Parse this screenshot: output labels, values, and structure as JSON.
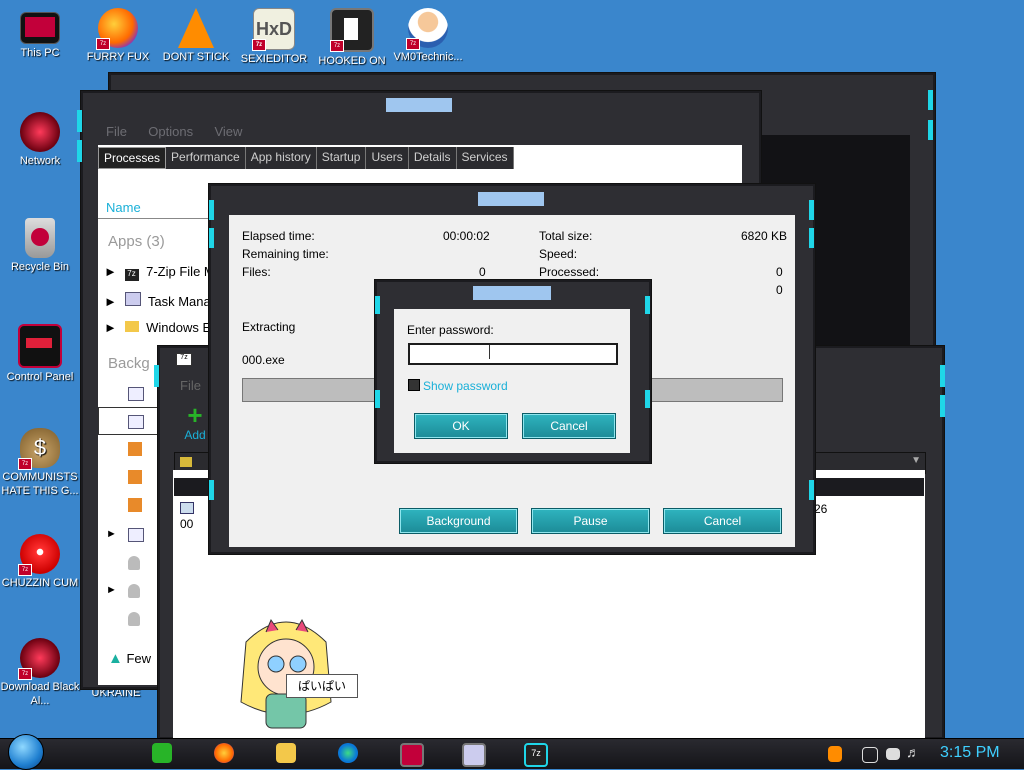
{
  "desktop_icons": [
    {
      "label": "This PC"
    },
    {
      "label": "FURRY FUX"
    },
    {
      "label": "DONT STICK"
    },
    {
      "label": "SEXIEDITOR"
    },
    {
      "label": "HOOKED ON"
    },
    {
      "label": "VM0Technic..."
    },
    {
      "label": "Network"
    },
    {
      "label": "Recycle Bin"
    },
    {
      "label": "Control Panel"
    },
    {
      "label": "COMMUNISTS HATE THIS G..."
    },
    {
      "label": "CHUZZIN CUM"
    },
    {
      "label": "Download Black Al..."
    },
    {
      "label": "UKRAINE"
    }
  ],
  "task_manager": {
    "menu": [
      "File",
      "Options",
      "View"
    ],
    "tabs": [
      "Processes",
      "Performance",
      "App history",
      "Startup",
      "Users",
      "Details",
      "Services"
    ],
    "column_name": "Name",
    "apps_group": "Apps (3)",
    "apps": [
      "7-Zip File M",
      "Task Manag",
      "Windows Ex"
    ],
    "background_group": "Backg",
    "fewer_details": "Few"
  },
  "file_manager": {
    "menu_file": "File",
    "add_label": "Add",
    "row_name": "00",
    "size_fragment": "26"
  },
  "extract_dialog": {
    "elapsed_label": "Elapsed time:",
    "elapsed_value": "00:00:02",
    "remaining_label": "Remaining time:",
    "files_label": "Files:",
    "files_value": "0",
    "total_size_label": "Total size:",
    "total_size_value": "6820 KB",
    "speed_label": "Speed:",
    "processed_label": "Processed:",
    "processed_value": "0",
    "extra_value": "0",
    "status": "Extracting",
    "filename": "000.exe",
    "progress": 0,
    "buttons": {
      "background": "Background",
      "pause": "Pause",
      "cancel": "Cancel"
    }
  },
  "password_dialog": {
    "prompt": "Enter password:",
    "value": "",
    "show_password": "Show password",
    "ok": "OK",
    "cancel": "Cancel"
  },
  "sticker": {
    "speech": "ぱいぱい"
  },
  "taskbar": {
    "clock": "3:15 PM"
  },
  "colors": {
    "desktop": "#3a86cc",
    "accent_cyan": "#1fd6e8",
    "button_teal": "#1c8b97",
    "clock": "#3fd0ff"
  }
}
